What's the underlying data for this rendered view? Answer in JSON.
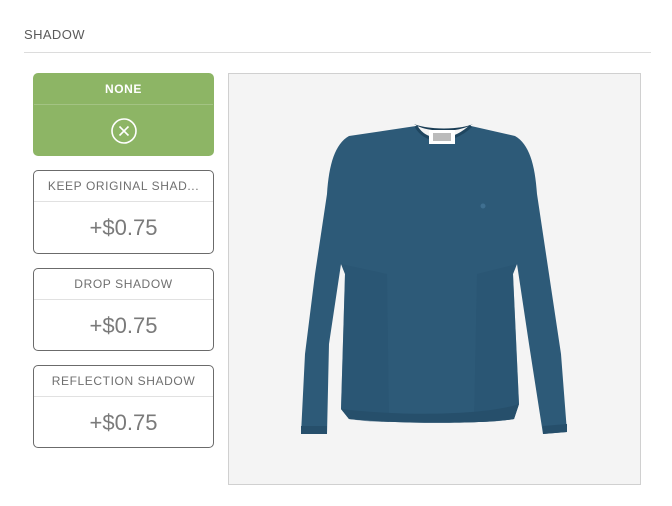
{
  "section": {
    "title": "SHADOW"
  },
  "options": [
    {
      "label": "NONE",
      "icon": "cancel-circle-icon",
      "selected": true
    },
    {
      "label": "KEEP ORIGINAL SHAD...",
      "price": "+$0.75",
      "selected": false
    },
    {
      "label": "DROP SHADOW",
      "price": "+$0.75",
      "selected": false
    },
    {
      "label": "REFLECTION SHADOW",
      "price": "+$0.75",
      "selected": false
    }
  ],
  "preview": {
    "image": "blue-long-sleeve-shirt"
  },
  "colors": {
    "accent": "#8db565",
    "garment": "#2d5a78"
  }
}
